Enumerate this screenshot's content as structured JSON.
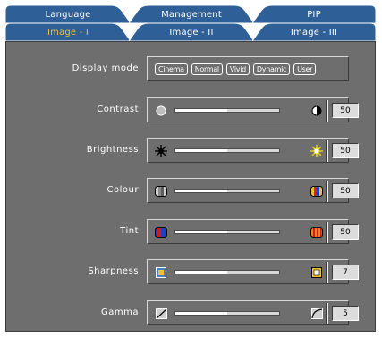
{
  "tabs_top": [
    {
      "label": "Language"
    },
    {
      "label": "Management"
    },
    {
      "label": "PIP"
    }
  ],
  "tabs_bottom": [
    {
      "label": "Image - I",
      "active": true
    },
    {
      "label": "Image - II"
    },
    {
      "label": "Image - III"
    }
  ],
  "display_mode": {
    "label": "Display mode",
    "options": [
      "Cinema",
      "Normal",
      "Vivid",
      "Dynamic",
      "User"
    ]
  },
  "settings": [
    {
      "label": "Contrast",
      "value": "50",
      "fraction": 0.5,
      "left_icon": "contrast-low-icon",
      "right_icon": "contrast-high-icon"
    },
    {
      "label": "Brightness",
      "value": "50",
      "fraction": 0.5,
      "left_icon": "brightness-low-icon",
      "right_icon": "brightness-high-icon"
    },
    {
      "label": "Colour",
      "value": "50",
      "fraction": 0.5,
      "left_icon": "colour-low-icon",
      "right_icon": "colour-high-icon"
    },
    {
      "label": "Tint",
      "value": "50",
      "fraction": 0.5,
      "left_icon": "tint-low-icon",
      "right_icon": "tint-high-icon"
    },
    {
      "label": "Sharpness",
      "value": "7",
      "fraction": 0.5,
      "left_icon": "sharpness-low-icon",
      "right_icon": "sharpness-high-icon"
    },
    {
      "label": "Gamma",
      "value": "5",
      "fraction": 0.5,
      "left_icon": "gamma-low-icon",
      "right_icon": "gamma-high-icon"
    }
  ],
  "colors": {
    "tab_blue": "#2f5f97",
    "tab_blue_dark": "#1f4676",
    "panel_grey": "#6e6e6e",
    "active_text": "#f0c030"
  }
}
